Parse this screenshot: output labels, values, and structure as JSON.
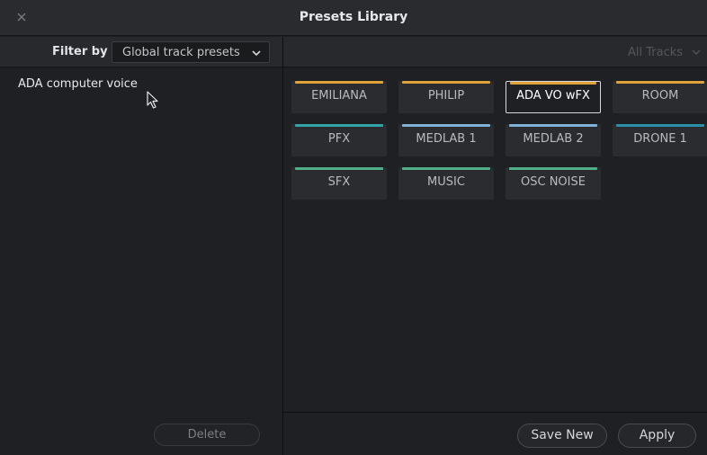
{
  "window": {
    "title": "Presets Library"
  },
  "filter": {
    "label": "Filter by",
    "value": "Global track presets"
  },
  "tracks_filter": {
    "value": "All Tracks"
  },
  "preset_list": {
    "items": [
      "ADA computer voice"
    ]
  },
  "presets": [
    {
      "label": "EMILIANA",
      "color": "#e0a33a",
      "selected": false
    },
    {
      "label": "PHILIP",
      "color": "#e0a33a",
      "selected": false
    },
    {
      "label": "ADA VO wFX",
      "color": "#e0a33a",
      "selected": true
    },
    {
      "label": "ROOM",
      "color": "#e0a33a",
      "selected": false
    },
    {
      "label": "PFX",
      "color": "#2fa5a8",
      "selected": false
    },
    {
      "label": "MEDLAB 1",
      "color": "#7fb2d6",
      "selected": false
    },
    {
      "label": "MEDLAB 2",
      "color": "#7fb2d6",
      "selected": false
    },
    {
      "label": "DRONE 1",
      "color": "#2a8fa8",
      "selected": false
    },
    {
      "label": "SFX",
      "color": "#4fb08a",
      "selected": false
    },
    {
      "label": "MUSIC",
      "color": "#4fb08a",
      "selected": false
    },
    {
      "label": "OSC NOISE",
      "color": "#4fb08a",
      "selected": false
    }
  ],
  "buttons": {
    "delete": "Delete",
    "save_new": "Save New",
    "apply": "Apply"
  },
  "icons": {
    "close": "close-icon",
    "dropdown": "chevron-down-icon",
    "cursor": "mouse-pointer-icon"
  }
}
